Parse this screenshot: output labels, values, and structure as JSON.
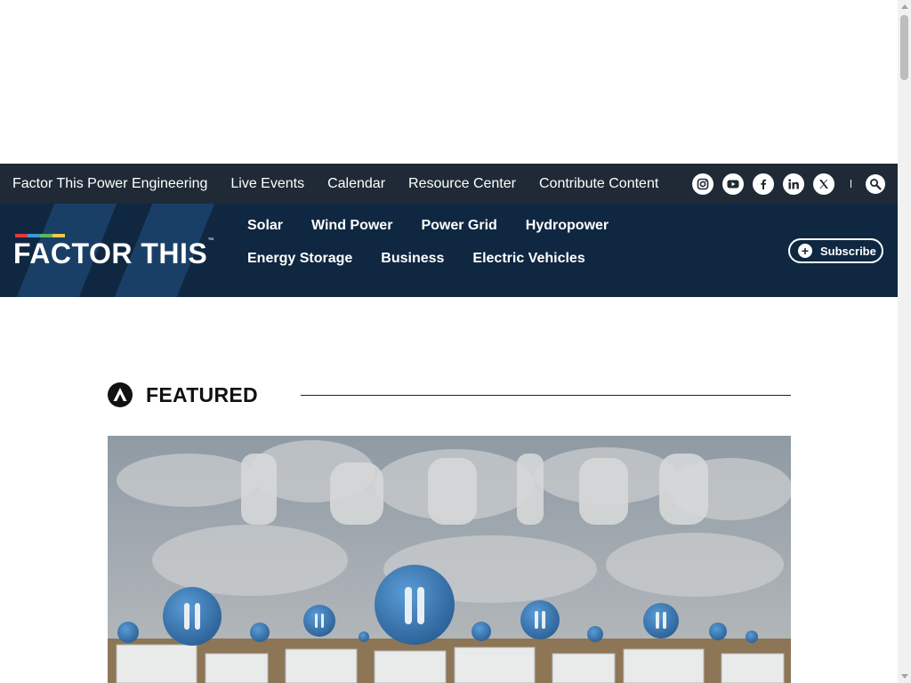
{
  "top_bar": {
    "links": [
      {
        "label": "Factor This Power Engineering"
      },
      {
        "label": "Live Events"
      },
      {
        "label": "Calendar"
      },
      {
        "label": "Resource Center"
      },
      {
        "label": "Contribute Content"
      }
    ],
    "social_icons": [
      "instagram-icon",
      "youtube-icon",
      "facebook-icon",
      "linkedin-icon",
      "x-icon"
    ],
    "search_icon": "search-icon"
  },
  "main_nav": {
    "logo_text": "FACTOR THIS",
    "logo_tm": "™",
    "logo_bar_colors": [
      "#e53935",
      "#3d9bd8",
      "#5cb85c",
      "#f2c94c"
    ],
    "links": [
      {
        "label": "Solar"
      },
      {
        "label": "Wind Power"
      },
      {
        "label": "Power Grid"
      },
      {
        "label": "Hydropower"
      },
      {
        "label": "Energy Storage"
      },
      {
        "label": "Business"
      },
      {
        "label": "Electric Vehicles"
      }
    ],
    "subscribe_label": "Subscribe"
  },
  "featured": {
    "title": "FEATURED",
    "hero_image": "tariffs-clouds-battery-storage-image"
  },
  "colors": {
    "topbar_bg": "#1f2a36",
    "nav_bg": "#0f2741",
    "nav_stripe": "#1a3f66",
    "text_white": "#ffffff"
  }
}
